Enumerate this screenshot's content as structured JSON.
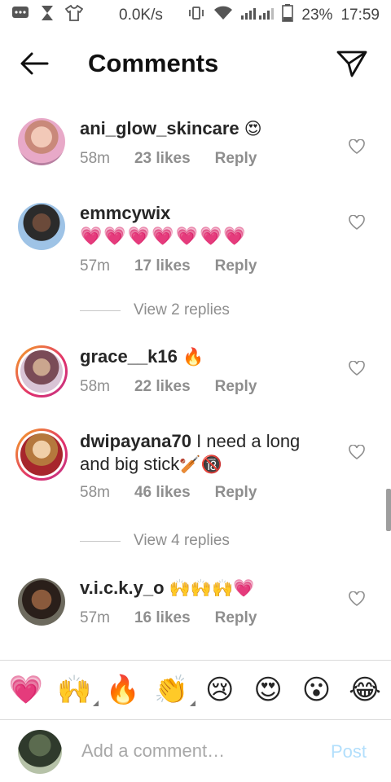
{
  "status_bar": {
    "speed": "0.0K/s",
    "battery": "23%",
    "time": "17:59"
  },
  "header": {
    "title": "Comments"
  },
  "comments": [
    {
      "username": "ani_glow_skincare",
      "text": "",
      "emoji": "😍",
      "time": "58m",
      "likes": "23 likes",
      "reply": "Reply"
    },
    {
      "username": "emmcywix",
      "text": "",
      "emoji": "💗💗💗💗💗💗💗",
      "time": "57m",
      "likes": "17 likes",
      "reply": "Reply"
    },
    {
      "username": "grace__k16",
      "text": "",
      "emoji": "🔥",
      "time": "58m",
      "likes": "22 likes",
      "reply": "Reply"
    },
    {
      "username": "dwipayana70",
      "text": " I need a long and big stick",
      "emoji": "🏏🔞",
      "time": "58m",
      "likes": "46 likes",
      "reply": "Reply"
    },
    {
      "username": "v.i.c.k.y_o",
      "text": "",
      "emoji": "🙌🙌🙌💗",
      "time": "57m",
      "likes": "16 likes",
      "reply": "Reply"
    }
  ],
  "view_replies": [
    {
      "label": "View 2 replies"
    },
    {
      "label": "View 4 replies"
    }
  ],
  "emoji_bar": [
    "💗",
    "🙌",
    "🔥",
    "👏",
    "😢",
    "😍",
    "😮",
    "😂"
  ],
  "composer": {
    "placeholder": "Add a comment…",
    "post_label": "Post"
  },
  "colors": {
    "accent_blue_disabled": "#b2dffc",
    "secondary_text": "#8e8e8e",
    "heart_pink": "#e1306c"
  }
}
